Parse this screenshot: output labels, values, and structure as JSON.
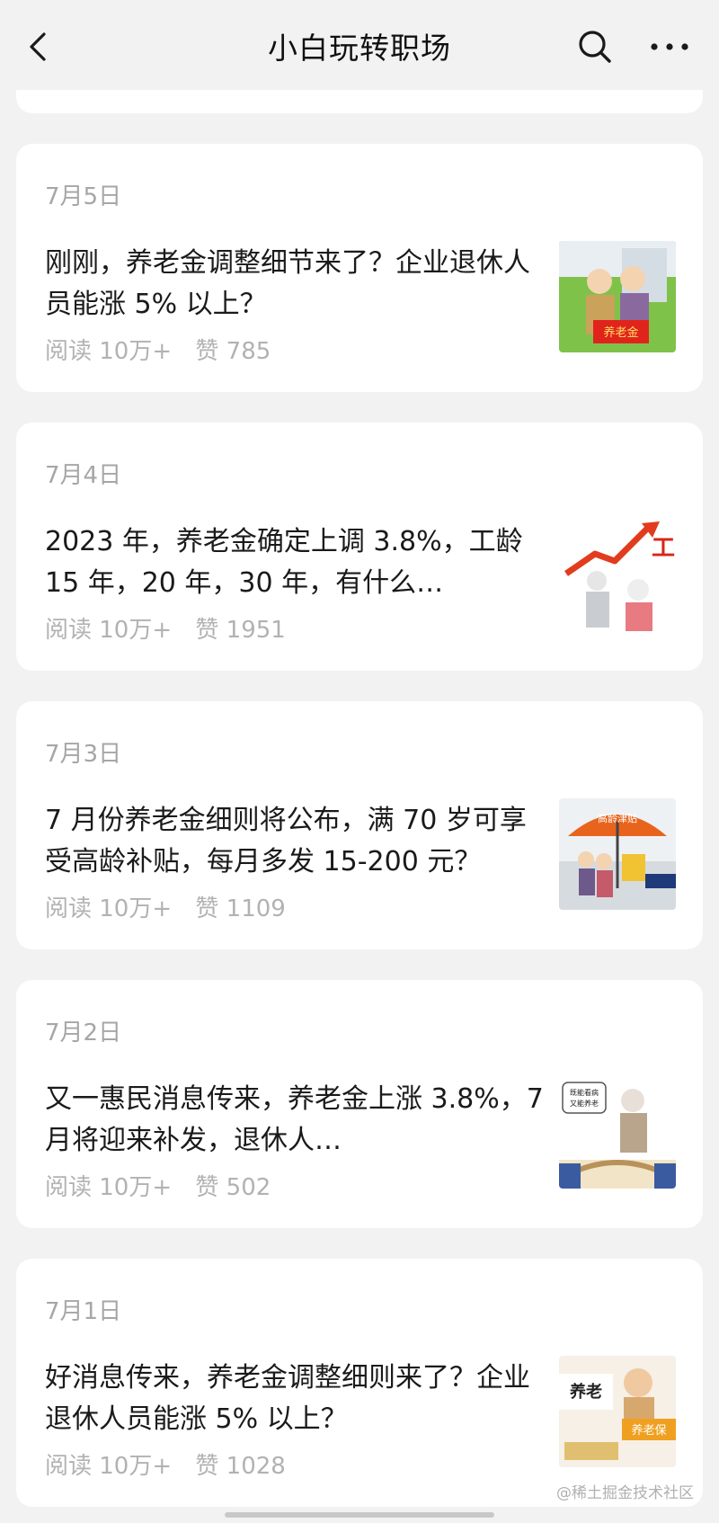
{
  "header": {
    "title": "小白玩转职场"
  },
  "articles": [
    {
      "date": "7月5日",
      "headline": "刚刚，养老金调整细节来了？企业退休人员能涨 5% 以上？",
      "reads": "阅读 10万+",
      "likes": "赞 785",
      "thumb_text": "养老金"
    },
    {
      "date": "7月4日",
      "headline": "2023 年，养老金确定上调 3.8%，工龄 15 年，20 年，30 年，有什么…",
      "reads": "阅读 10万+",
      "likes": "赞 1951",
      "thumb_text": "工"
    },
    {
      "date": "7月3日",
      "headline": "7 月份养老金细则将公布，满 70 岁可享受高龄补贴，每月多发 15-200 元？",
      "reads": "阅读 10万+",
      "likes": "赞 1109",
      "thumb_text": "高龄津贴"
    },
    {
      "date": "7月2日",
      "headline": "又一惠民消息传来，养老金上涨 3.8%，7 月将迎来补发，退休人…",
      "reads": "阅读 10万+",
      "likes": "赞 502",
      "thumb_text": "既能看病又能养老"
    },
    {
      "date": "7月1日",
      "headline": "好消息传来，养老金调整细则来了？企业退休人员能涨 5% 以上？",
      "reads": "阅读 10万+",
      "likes": "赞 1028",
      "thumb_text": "养老保"
    }
  ],
  "watermark": "@稀土掘金技术社区",
  "icons": {
    "back": "chevron-left-icon",
    "search": "search-icon",
    "more": "more-dots-icon"
  },
  "colors": {
    "background": "#f2f2f2",
    "card": "#ffffff",
    "title": "#111111",
    "meta": "#b2b2b2"
  }
}
